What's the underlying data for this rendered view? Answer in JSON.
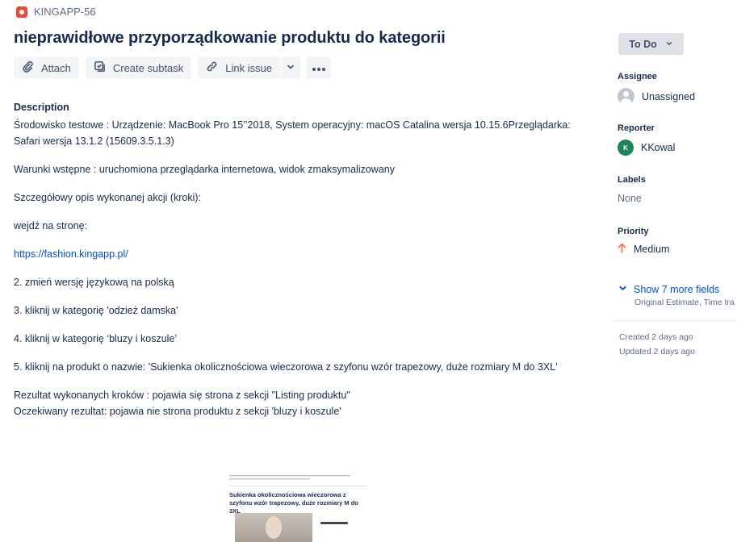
{
  "issue": {
    "key": "KINGAPP-56",
    "type_icon": "bug-icon",
    "title": "nieprawidłowe przyporządkowanie produktu do kategorii"
  },
  "toolbar": {
    "attach_label": "Attach",
    "create_subtask_label": "Create subtask",
    "link_issue_label": "Link issue"
  },
  "description": {
    "label": "Description",
    "env_line1": "Środowisko testowe : Urządzenie: MacBook Pro 15’’2018, System operacyjny: macOS Catalina wersja 10.15.6Przeglądarka:",
    "env_line2": "Safari wersja 13.1.2 (15609.3.5.1.3)",
    "preconditions": "Warunki wstępne : uruchomiona przeglądarka internetowa, widok zmaksymalizowany",
    "steps_intro": "Szczegółowy opis wykonanej akcji (kroki):",
    "step1": "wejdź na stronę:",
    "url": "https://fashion.kingapp.pl/",
    "step2": "2. zmień wersję językową na polską",
    "step3": "3. kliknij w kategorię 'odzież damska'",
    "step4": "4. kliknij w kategorię ‘bluzy i koszule’",
    "step5": "5. kliknij na produkt o nazwie: 'Sukienka okolicznościowa wieczorowa z szyfonu wzór trapezowy, duże rozmiary M do 3XL'",
    "result": "Rezultat wykonanych kroków : pojawia się strona z sekcji \"Listing produktu\"",
    "expected": "Oczekiwany rezultat: pojawia nie strona produktu z sekcji 'bluzy i koszule'"
  },
  "attachment": {
    "title": "Sukienka okolicznościowa wieczorowa z szyfonu wzór trapezowy, duże rozmiary M do 3XL"
  },
  "sidebar": {
    "status": "To Do",
    "assignee_label": "Assignee",
    "assignee_value": "Unassigned",
    "reporter_label": "Reporter",
    "reporter_initial": "K",
    "reporter_value": "KKowal",
    "labels_label": "Labels",
    "labels_value": "None",
    "priority_label": "Priority",
    "priority_value": "Medium",
    "show_more": "Show 7 more fields",
    "more_fields_sub": "Original Estimate, Time tra",
    "created": "Created 2 days ago",
    "updated": "Updated 2 days ago"
  },
  "colors": {
    "bug": "#e5493a",
    "link": "#0052cc",
    "priority_medium": "#ff7452",
    "reporter_avatar": "#1f845a"
  }
}
